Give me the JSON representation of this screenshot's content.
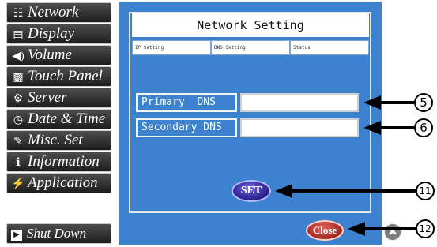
{
  "sidebar": {
    "items": [
      {
        "icon": "network-icon",
        "glyph": "☷",
        "label": "Network"
      },
      {
        "icon": "display-icon",
        "glyph": "▤",
        "label": "Display"
      },
      {
        "icon": "volume-icon",
        "glyph": "◀)",
        "label": "Volume"
      },
      {
        "icon": "touch-panel-icon",
        "glyph": "▩",
        "label": "Touch Panel"
      },
      {
        "icon": "server-icon",
        "glyph": "⚙",
        "label": "Server"
      },
      {
        "icon": "clock-icon",
        "glyph": "◷",
        "label": "Date & Time"
      },
      {
        "icon": "misc-icon",
        "glyph": "✎",
        "label": "Misc. Set"
      },
      {
        "icon": "info-icon",
        "glyph": "ℹ",
        "label": "Information"
      },
      {
        "icon": "lightning-icon",
        "glyph": "⚡",
        "label": "Application"
      }
    ],
    "shutdown": {
      "icon": "power-icon",
      "glyph": "▶",
      "label": "Shut Down"
    }
  },
  "panel": {
    "title": "Network Setting",
    "tabs": [
      {
        "label": "IP Setting"
      },
      {
        "label": "DNS Setting"
      },
      {
        "label": "Status"
      }
    ],
    "primary_label": "Primary  DNS",
    "secondary_label": "Secondary DNS",
    "set_label": "SET",
    "close_label": "Close",
    "x_label": "✖"
  },
  "callouts": {
    "c5": "5",
    "c6": "6",
    "c11": "11",
    "c12": "12"
  },
  "colors": {
    "panel_bg": "#3d82cf",
    "sidebar_btn": "#333333",
    "set": "#3a2fb0",
    "close": "#c0392b"
  }
}
